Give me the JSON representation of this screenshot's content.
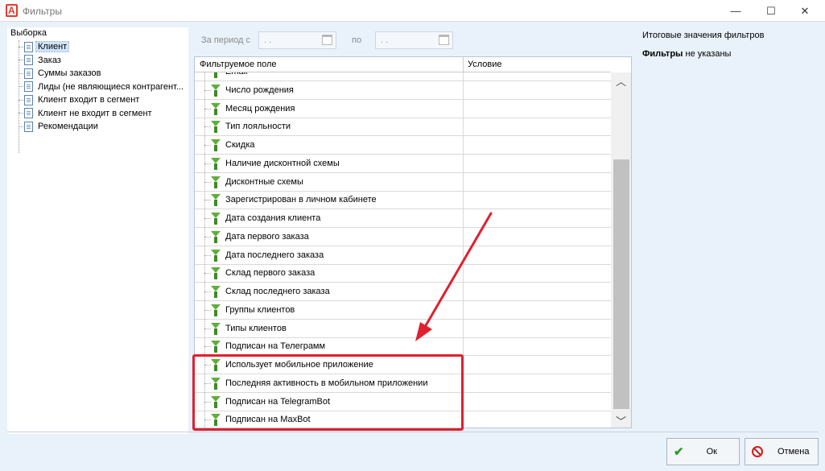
{
  "window": {
    "title": "Фильтры",
    "logo_letter": "A",
    "minimize_glyph": "—",
    "maximize_glyph": "☐",
    "close_glyph": "✕"
  },
  "tree": {
    "root": "Выборка",
    "items": [
      {
        "label": "Клиент",
        "selected": true
      },
      {
        "label": "Заказ"
      },
      {
        "label": "Суммы заказов"
      },
      {
        "label": "Лиды (не являющиеся контрагент..."
      },
      {
        "label": "Клиент входит в сегмент"
      },
      {
        "label": "Клиент не входит в сегмент"
      },
      {
        "label": "Рекомендации"
      }
    ]
  },
  "period": {
    "from_label": "За период с",
    "from_value": ". .",
    "to_label": "по",
    "to_value": ". ."
  },
  "grid": {
    "columns": [
      "Фильтруемое поле",
      "Условие"
    ],
    "rows": [
      "Email",
      "Число рождения",
      "Месяц рождения",
      "Тип лояльности",
      "Скидка",
      "Наличие дисконтной схемы",
      "Дисконтные схемы",
      "Зарегистрирован в личном кабинете",
      "Дата создания клиента",
      "Дата первого заказа",
      "Дата последнего заказа",
      "Склад первого заказа",
      "Склад последнего заказа",
      "Группы клиентов",
      "Типы клиентов",
      "Подписан на Телеграмм",
      "Использует мобильное приложение",
      "Последняя активность в мобильном приложении",
      "Подписан на TelegramBot",
      "Подписан на MaxBot"
    ],
    "scroll_up_glyph": "︿",
    "scroll_down_glyph": "﹀"
  },
  "summary": {
    "title": "Итоговые значения фильтров",
    "bold": "Фильтры",
    "rest": " не указаны"
  },
  "buttons": {
    "ok": "Ок",
    "cancel": "Отмена"
  },
  "colors": {
    "accent_red": "#e0202e",
    "funnel_green": "#5fae3a"
  }
}
